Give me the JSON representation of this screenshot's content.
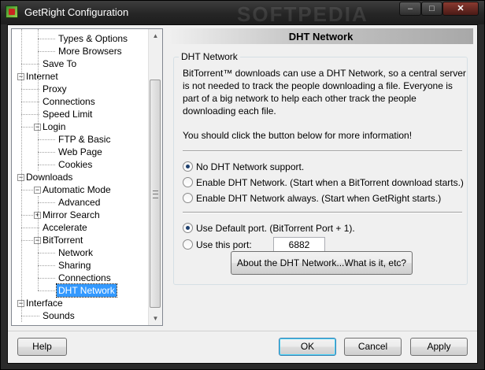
{
  "window": {
    "title": "GetRight Configuration",
    "watermark": "SOFTPEDIA",
    "controls": {
      "minimize": "–",
      "maximize": "□",
      "close": "✕"
    }
  },
  "tree": {
    "items": [
      {
        "label": "Types & Options",
        "level": 3
      },
      {
        "label": "More Browsers",
        "level": 3
      },
      {
        "label": "Save To",
        "level": 2
      },
      {
        "label": "Internet",
        "level": 1,
        "expander": "−"
      },
      {
        "label": "Proxy",
        "level": 2
      },
      {
        "label": "Connections",
        "level": 2
      },
      {
        "label": "Speed Limit",
        "level": 2
      },
      {
        "label": "Login",
        "level": 2,
        "expander": "−"
      },
      {
        "label": "FTP & Basic",
        "level": 3
      },
      {
        "label": "Web Page",
        "level": 3
      },
      {
        "label": "Cookies",
        "level": 3
      },
      {
        "label": "Downloads",
        "level": 1,
        "expander": "−"
      },
      {
        "label": "Automatic Mode",
        "level": 2,
        "expander": "−"
      },
      {
        "label": "Advanced",
        "level": 3
      },
      {
        "label": "Mirror Search",
        "level": 2,
        "expander": "+"
      },
      {
        "label": "Accelerate",
        "level": 2
      },
      {
        "label": "BitTorrent",
        "level": 2,
        "expander": "−"
      },
      {
        "label": "Network",
        "level": 3
      },
      {
        "label": "Sharing",
        "level": 3
      },
      {
        "label": "Connections",
        "level": 3
      },
      {
        "label": "DHT Network",
        "level": 3,
        "selected": true
      },
      {
        "label": "Interface",
        "level": 1,
        "expander": "−"
      },
      {
        "label": "Sounds",
        "level": 2
      }
    ]
  },
  "panel": {
    "title": "DHT Network",
    "group_label": "DHT Network",
    "description": "BitTorrent™ downloads can use a DHT Network, so a central server is not needed to track the people downloading a file.  Everyone is part of a big network to help each other track the people downloading each file.",
    "instruction": "You should click the button below for more information!",
    "mode_options": [
      {
        "label": "No DHT Network support.",
        "checked": true
      },
      {
        "label": "Enable DHT Network.  (Start when a BitTorrent download starts.)",
        "checked": false
      },
      {
        "label": "Enable DHT Network always.  (Start when GetRight starts.)",
        "checked": false
      }
    ],
    "port_options": [
      {
        "label": "Use Default port.  (BitTorrent Port + 1).",
        "checked": true
      },
      {
        "label": "Use this port:",
        "checked": false
      }
    ],
    "port_value": "6882",
    "about_button": "About the DHT Network...What is it, etc?"
  },
  "footer": {
    "help": "Help",
    "ok": "OK",
    "cancel": "Cancel",
    "apply": "Apply"
  }
}
